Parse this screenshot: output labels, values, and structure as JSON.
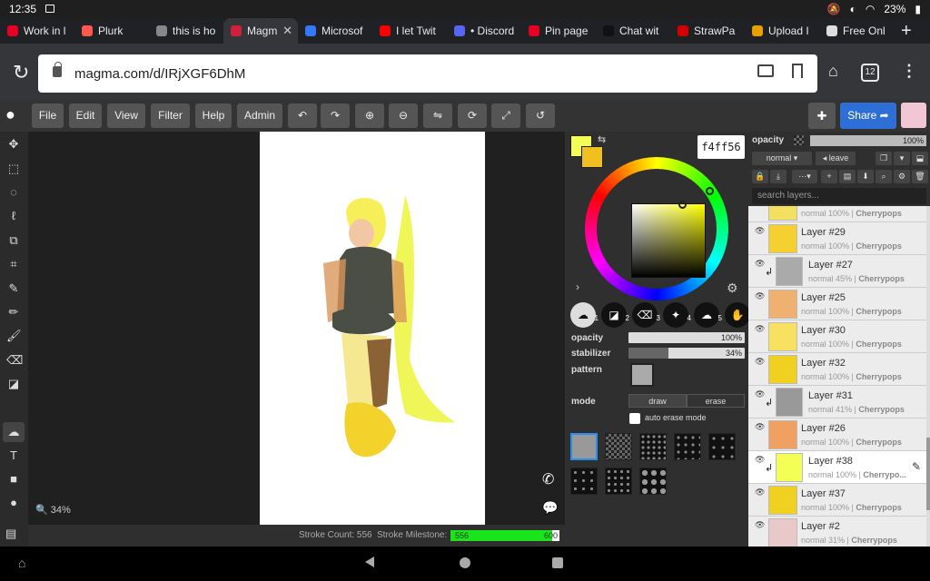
{
  "status": {
    "time": "12:35",
    "battery": "23%"
  },
  "tabs": [
    {
      "label": "Work in l",
      "color": "#e60023"
    },
    {
      "label": "Plurk",
      "color": "#ff574d"
    },
    {
      "label": "this is ho",
      "color": "#888888"
    },
    {
      "label": "Magm",
      "color": "#d0213a",
      "active": true
    },
    {
      "label": "Microsof",
      "color": "#3478f6"
    },
    {
      "label": "I let Twit",
      "color": "#ff0000"
    },
    {
      "label": "• Discord",
      "color": "#5865f2"
    },
    {
      "label": "Pin page",
      "color": "#e60023"
    },
    {
      "label": "Chat wit",
      "color": "#111111"
    },
    {
      "label": "StrawPa",
      "color": "#d40000"
    },
    {
      "label": "Upload I",
      "color": "#e8a000"
    },
    {
      "label": "Free Onl",
      "color": "#dddddd"
    }
  ],
  "address": {
    "url": "magma.com/d/IRjXGF6DhM",
    "tab_count": "12"
  },
  "toolbar": {
    "menus": [
      "File",
      "Edit",
      "View",
      "Filter",
      "Help",
      "Admin"
    ],
    "share_label": "Share"
  },
  "canvas": {
    "zoom": "34%"
  },
  "footer": {
    "stroke_count_label": "Stroke Count: 556",
    "milestone_label": "Stroke Milestone:",
    "milestone_value": "556",
    "milestone_max": "600",
    "milestone_fraction": 0.93
  },
  "color": {
    "hex": "f4ff56",
    "primary": "#f4ff56",
    "secondary": "#f0c020"
  },
  "brush": {
    "opacity_label": "opacity",
    "opacity_value": "100%",
    "stabilizer_label": "stabilizer",
    "stabilizer_value": "34%",
    "pattern_label": "pattern",
    "mode_label": "mode",
    "mode_draw": "draw",
    "mode_erase": "erase",
    "auto_erase_label": "auto erase mode",
    "slots": [
      "1",
      "2",
      "3",
      "4",
      "5",
      "6"
    ]
  },
  "layers_panel": {
    "opacity_label": "opacity",
    "opacity_value": "100%",
    "blend_mode": "normal",
    "leave_label": "leave",
    "search_placeholder": "search layers...",
    "layers": [
      {
        "name": "",
        "meta": "normal 100% | ",
        "owner": "Cherrypops",
        "thumb": "#f4e060",
        "clipped": false,
        "selected": false
      },
      {
        "name": "Layer #29",
        "meta": "normal 100% | ",
        "owner": "Cherrypops",
        "thumb": "#f4d030",
        "clipped": false,
        "selected": false
      },
      {
        "name": "Layer #27",
        "meta": "normal 45% | ",
        "owner": "Cherrypops",
        "thumb": "#aaaaaa",
        "clipped": true,
        "selected": false
      },
      {
        "name": "Layer #25",
        "meta": "normal 100% | ",
        "owner": "Cherrypops",
        "thumb": "#f0b070",
        "clipped": false,
        "selected": false
      },
      {
        "name": "Layer #30",
        "meta": "normal 100% | ",
        "owner": "Cherrypops",
        "thumb": "#f8e060",
        "clipped": false,
        "selected": false
      },
      {
        "name": "Layer #32",
        "meta": "normal 100% | ",
        "owner": "Cherrypops",
        "thumb": "#f0d020",
        "clipped": false,
        "selected": false
      },
      {
        "name": "Layer #31",
        "meta": "normal 41% | ",
        "owner": "Cherrypops",
        "thumb": "#999999",
        "clipped": true,
        "selected": false
      },
      {
        "name": "Layer #26",
        "meta": "normal 100% | ",
        "owner": "Cherrypops",
        "thumb": "#f0a060",
        "clipped": false,
        "selected": false
      },
      {
        "name": "Layer #38",
        "meta": "normal 100% | ",
        "owner": "Cherrypo...",
        "thumb": "#f4ff56",
        "clipped": true,
        "selected": true
      },
      {
        "name": "Layer #37",
        "meta": "normal 100% | ",
        "owner": "Cherrypops",
        "thumb": "#f0d020",
        "clipped": false,
        "selected": false
      },
      {
        "name": "Layer #2",
        "meta": "normal 31% | ",
        "owner": "Cherrypops",
        "thumb": "#e8c8c8",
        "clipped": false,
        "selected": false
      }
    ]
  }
}
